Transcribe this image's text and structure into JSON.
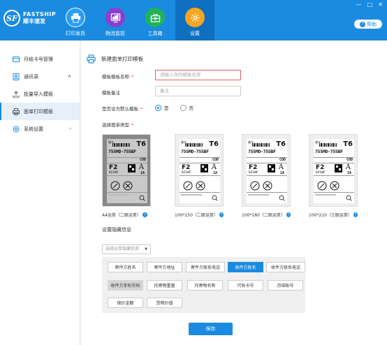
{
  "app": {
    "brand_en": "FASTSHIP",
    "brand_cn": "顺丰速发",
    "logo_letters": "SF"
  },
  "nav": [
    {
      "label": "打印发货",
      "icon": "printer-icon"
    },
    {
      "label": "物流监控",
      "icon": "chart-monitor-icon"
    },
    {
      "label": "工具箱",
      "icon": "toolbox-icon"
    },
    {
      "label": "设置",
      "icon": "gear-icon",
      "active": true
    }
  ],
  "window": {
    "min": "—",
    "max": "□",
    "close": "✕"
  },
  "help": {
    "label": "帮助",
    "q": "?"
  },
  "sidebar": {
    "items": [
      {
        "label": "月结卡号管理",
        "icon": "card-icon"
      },
      {
        "label": "通讯录",
        "icon": "contacts-icon",
        "arrow": "∧"
      },
      {
        "label": "批量导入模板",
        "icon": "upload-icon"
      },
      {
        "label": "面单打印模板",
        "icon": "print-template-icon",
        "active": true
      },
      {
        "label": "系统设置",
        "icon": "settings-icon",
        "arrow": "›"
      }
    ]
  },
  "main": {
    "title": "新建面单打印模板",
    "name_label": "模板模板名称",
    "name_placeholder": "请输入你的模板名称",
    "note_label": "模板备注",
    "note_placeholder": "备注",
    "default_label": "是否设为默认模板",
    "yes": "是",
    "no": "否",
    "type_label": "选择面单类型",
    "required_mark": "*",
    "templates": [
      {
        "label": "A4运单（二联运单）",
        "selected": true
      },
      {
        "label": "100*150（二联运单）"
      },
      {
        "label": "100*180（二联运单）"
      },
      {
        "label": "100*210（三联运单）"
      }
    ],
    "waybill_sample": {
      "brand": "顺丰",
      "code": "755MD-755BF",
      "big_char": "T6",
      "cod": "COD",
      "f2": "F2",
      "f2_sub": "021WF",
      "a": "A",
      "a1": "1A"
    },
    "hidden_title": "设置隐藏信息",
    "hidden_select": "选择运单隐藏信息",
    "hidden_select_caret": "▼",
    "hidden_fields": [
      {
        "label": "寄件方姓名"
      },
      {
        "label": "寄件方地址"
      },
      {
        "label": "寄件方联系电话"
      },
      {
        "label": "收件方姓名",
        "state": "on"
      },
      {
        "label": "收件方联系电话"
      },
      {
        "label": "收件方手机号码",
        "state": "grey"
      },
      {
        "label": "托寄物重量"
      },
      {
        "label": "托寄物名称"
      },
      {
        "label": "代收卡号"
      },
      {
        "label": "月结帐号"
      },
      {
        "label": "保价金额"
      },
      {
        "label": "货物价值"
      }
    ],
    "save_label": "保存",
    "q": "?"
  }
}
